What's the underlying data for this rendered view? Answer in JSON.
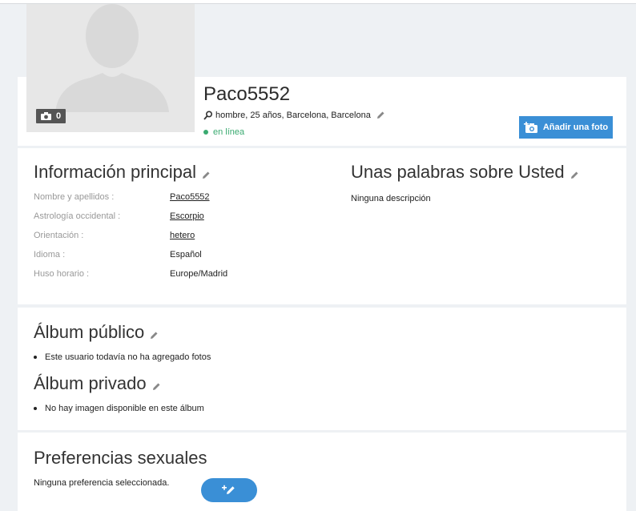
{
  "profile": {
    "username": "Paco5552",
    "meta": "hombre, 25 años, Barcelona, Barcelona",
    "status": "en línea",
    "photo_count": "0",
    "add_photo_label": "Añadir una foto"
  },
  "info": {
    "title": "Información principal",
    "fields": [
      {
        "label": "Nombre y apellidos :",
        "value": "Paco5552"
      },
      {
        "label": "Astrología occidental :",
        "value": "Escorpio"
      },
      {
        "label": "Orientación :",
        "value": "hetero"
      },
      {
        "label": "Idioma :",
        "value": "Español"
      },
      {
        "label": "Huso horario :",
        "value": "Europe/Madrid"
      }
    ]
  },
  "about": {
    "title": "Unas palabras sobre Usted",
    "text": "Ninguna descripción"
  },
  "albums": {
    "public_title": "Álbum público",
    "public_text": "Este usuario todavía no ha agregado fotos",
    "private_title": "Álbum privado",
    "private_text": "No hay imagen disponible en este álbum"
  },
  "prefs": {
    "title": "Preferencias sexuales",
    "text": "Ninguna preferencia seleccionada."
  },
  "colors": {
    "accent": "#3a8fd6",
    "online": "#3aaa70",
    "background": "#eef1f4"
  },
  "icons": {
    "camera": "camera-icon",
    "edit": "pencil-icon",
    "add_photo": "camera-plus-icon",
    "location": "location-pin-icon",
    "add_pref": "pencil-plus-icon"
  }
}
